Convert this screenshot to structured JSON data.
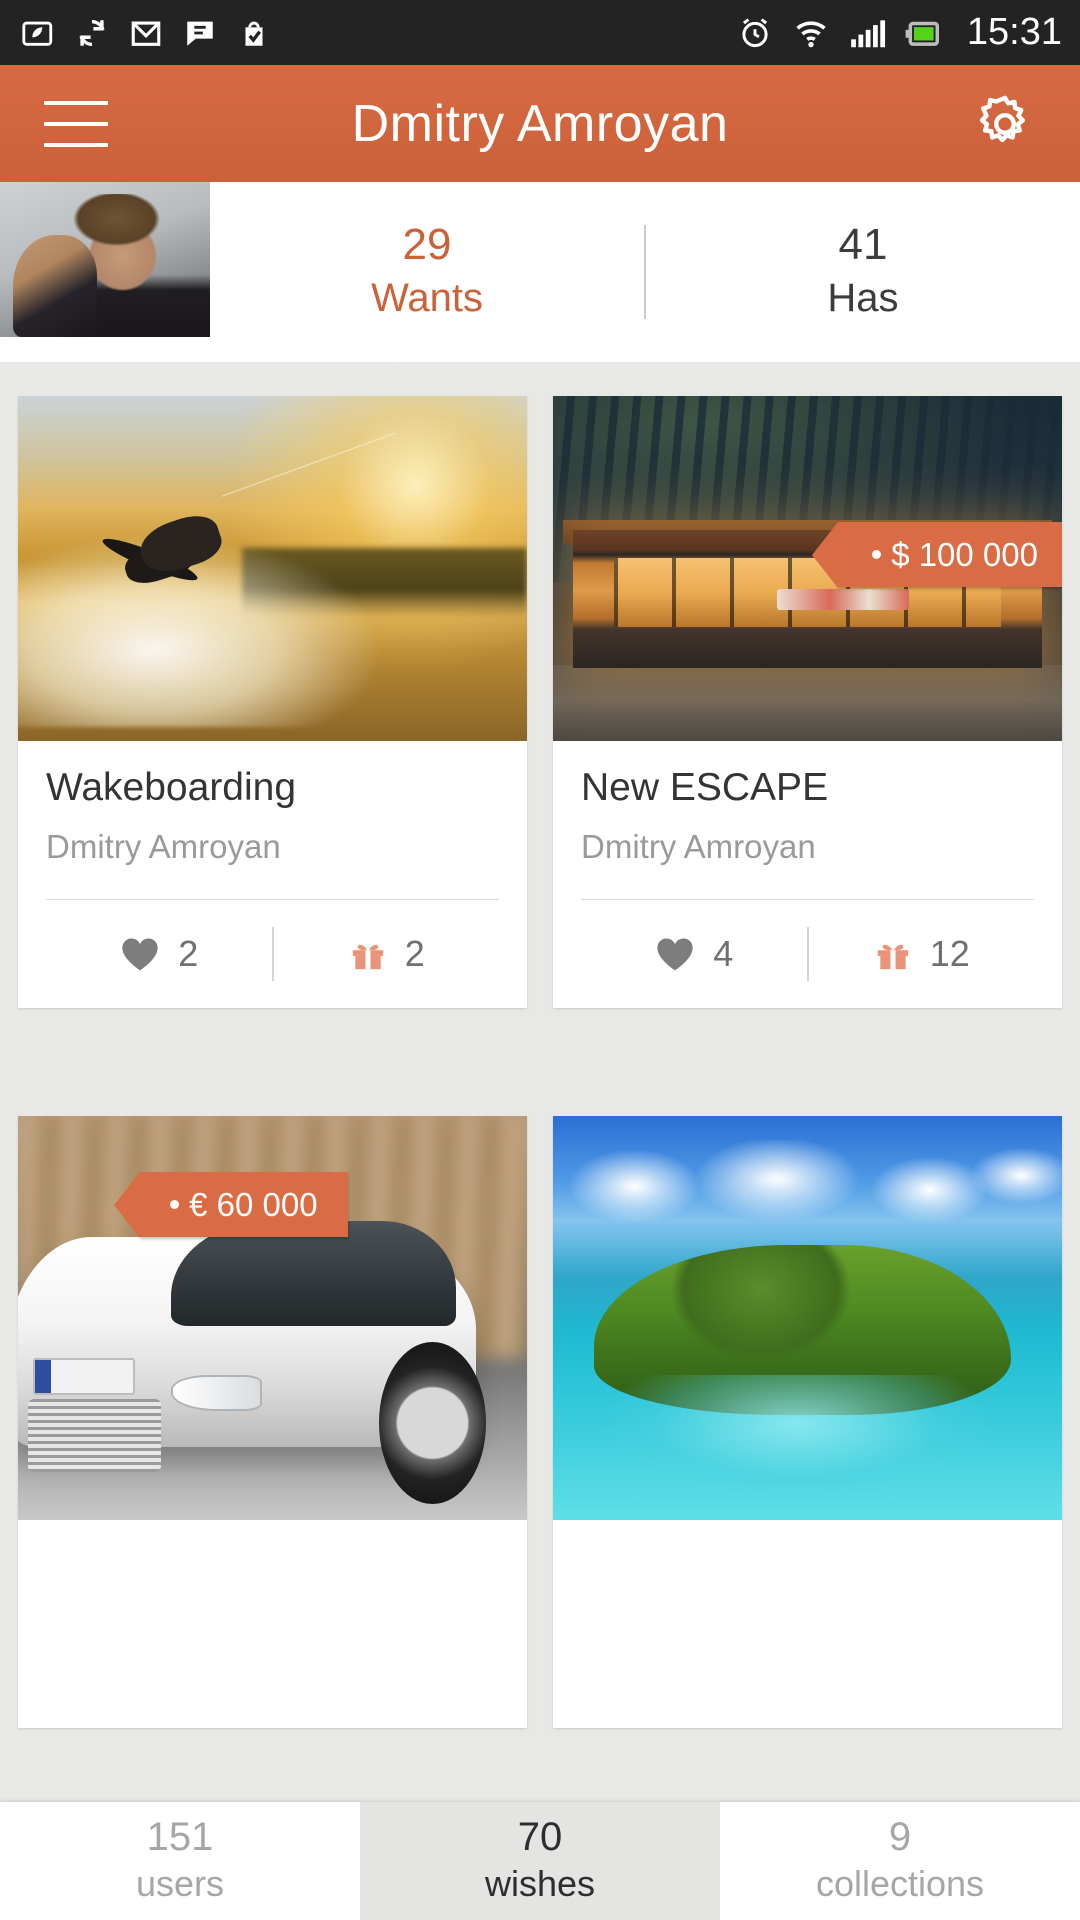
{
  "statusbar": {
    "time": "15:31",
    "left_icons": [
      "battery-saver-icon",
      "sync-icon",
      "gmail-icon",
      "messages-icon",
      "tasks-checkmark-icon"
    ],
    "right_icons": [
      "alarm-icon",
      "wifi-icon",
      "signal-icon",
      "battery-icon"
    ]
  },
  "appbar": {
    "title": "Dmitry Amroyan",
    "menu_icon": "hamburger-menu-icon",
    "settings_icon": "gear-icon"
  },
  "profile": {
    "avatar_alt": "user-avatar",
    "tabs": [
      {
        "count": "29",
        "label": "Wants",
        "active": true
      },
      {
        "count": "41",
        "label": "Has",
        "active": false
      }
    ]
  },
  "colors": {
    "accent": "#d0683f",
    "accent_text": "#cc6239",
    "tag_bg": "#d96c44",
    "page_bg": "#e8e8e6",
    "card_bg": "#ffffff",
    "title_text": "#343434",
    "muted_text": "#9a9a9a",
    "stat_text": "#707070"
  },
  "cards": [
    {
      "photo": "wakeboarding-photo",
      "title": "Wakeboarding",
      "author": "Dmitry Amroyan",
      "price": null,
      "likes": "2",
      "gifts": "2"
    },
    {
      "photo": "cabin-house-photo",
      "title": "New ESCAPE",
      "author": "Dmitry Amroyan",
      "price": "$ 100 000",
      "likes": "4",
      "gifts": "12"
    },
    {
      "photo": "white-audi-car-photo",
      "title": "",
      "author": "",
      "price": "€ 60 000",
      "likes": "",
      "gifts": ""
    },
    {
      "photo": "tropical-island-photo",
      "title": "",
      "author": "",
      "price": null,
      "likes": "",
      "gifts": ""
    }
  ],
  "bottomnav": [
    {
      "count": "151",
      "label": "users",
      "active": false
    },
    {
      "count": "70",
      "label": "wishes",
      "active": true
    },
    {
      "count": "9",
      "label": "collections",
      "active": false
    }
  ]
}
